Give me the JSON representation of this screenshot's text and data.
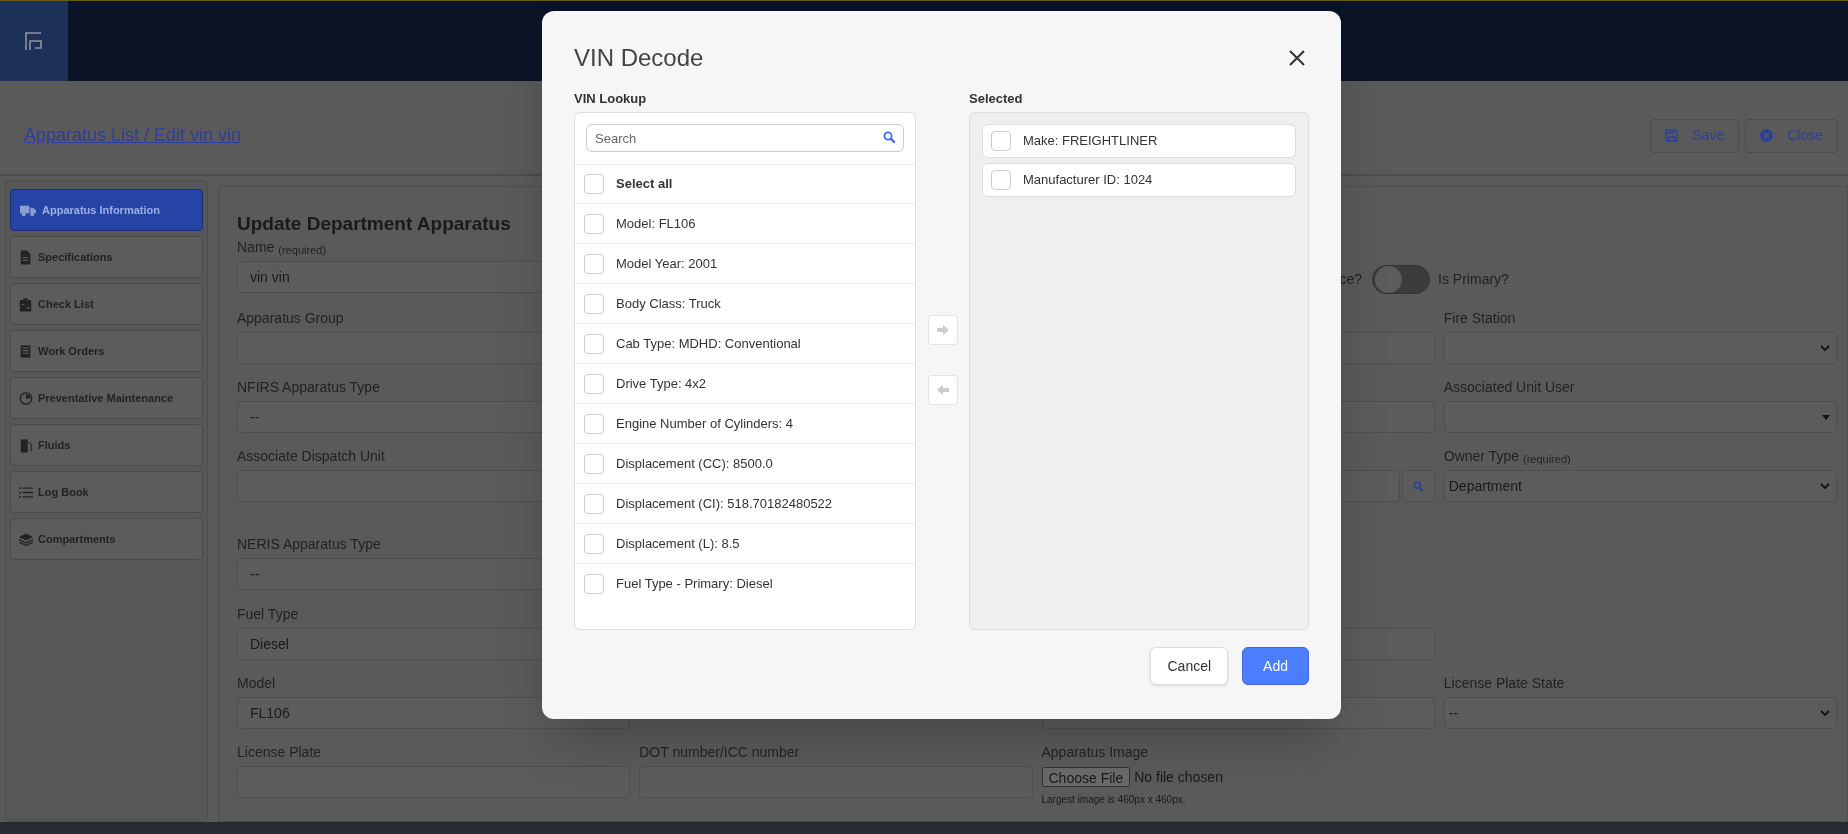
{
  "breadcrumb": "Apparatus List / Edit vin vin",
  "toolbar": [
    {
      "label": "Save",
      "kind": "save"
    },
    {
      "label": "Close",
      "kind": "close"
    }
  ],
  "sidebar": {
    "items": [
      {
        "label": "Apparatus Information",
        "kind": "truck",
        "selected": true
      },
      {
        "label": "Specifications",
        "kind": "document",
        "selected": false
      },
      {
        "label": "Check List",
        "kind": "clipboard",
        "selected": false
      },
      {
        "label": "Work Orders",
        "kind": "list-document",
        "selected": false
      },
      {
        "label": "Preventative Maintenance",
        "kind": "gauge",
        "selected": false
      },
      {
        "label": "Fluids",
        "kind": "fuel",
        "selected": false
      },
      {
        "label": "Log Book",
        "kind": "list",
        "selected": false
      },
      {
        "label": "Compartments",
        "kind": "layers",
        "selected": false
      }
    ]
  },
  "form": {
    "title": "Update Department Apparatus",
    "rows": [
      {
        "column_1": {
          "kind": "text",
          "label": "Name",
          "hint": "(required)",
          "value": "vin vin"
        },
        "column_3": {
          "kind": "toggles",
          "cut_label": "ce?",
          "toggle": {
            "label": "Is Primary?",
            "on": false
          }
        }
      },
      {
        "column_1": {
          "kind": "text",
          "label": "Apparatus Group"
        },
        "column_3": {
          "kind": "text"
        },
        "column_4": {
          "kind": "select",
          "label": "Fire Station"
        }
      },
      {
        "column_1": {
          "kind": "text",
          "label": "NFIRS Apparatus Type",
          "value": "--"
        },
        "column_3": {
          "kind": "text"
        },
        "column_4": {
          "kind": "dropdown",
          "label": "Associated Unit User"
        }
      },
      {
        "column_1": {
          "kind": "text",
          "label": "Associate Dispatch Unit"
        },
        "column_3": {
          "kind": "search"
        },
        "column_4": {
          "kind": "select",
          "label": "Owner Type",
          "hint": "(required)",
          "value": "Department"
        }
      },
      {
        "column_1": {
          "kind": "text",
          "label": "NERIS Apparatus Type",
          "value": "--"
        }
      },
      {
        "column_1": {
          "kind": "text",
          "label": "Fuel Type",
          "value": "Diesel"
        },
        "column_3": {
          "kind": "text"
        }
      },
      {
        "column_1": {
          "kind": "text",
          "label": "Model",
          "value": "FL106"
        },
        "column_3": {
          "kind": "text"
        },
        "column_4": {
          "kind": "select",
          "label": "License Plate State",
          "value": "--"
        }
      },
      {
        "column_1": {
          "kind": "text",
          "label": "License Plate"
        },
        "column_2": {
          "kind": "text",
          "label": "DOT number/ICC number"
        },
        "column_3": {
          "kind": "file",
          "label": "Apparatus Image",
          "button": "Choose File",
          "status": "No file chosen",
          "note": "Largest image is 460px x 460px."
        }
      }
    ]
  },
  "modal": {
    "title": "VIN Decode",
    "lookup": {
      "label": "VIN Lookup",
      "search": {
        "placeholder": "Search"
      },
      "select_all": {
        "label": "Select all",
        "checked": false
      },
      "items": [
        {
          "label": "Model: FL106",
          "checked": false
        },
        {
          "label": "Model Year: 2001",
          "checked": false
        },
        {
          "label": "Body Class: Truck",
          "checked": false
        },
        {
          "label": "Cab Type: MDHD: Conventional",
          "checked": false
        },
        {
          "label": "Drive Type: 4x2",
          "checked": false
        },
        {
          "label": "Engine Number of Cylinders: 4",
          "checked": false
        },
        {
          "label": "Displacement (CC): 8500.0",
          "checked": false
        },
        {
          "label": "Displacement (CI): 518.70182480522",
          "checked": false
        },
        {
          "label": "Displacement (L): 8.5",
          "checked": false
        },
        {
          "label": "Fuel Type - Primary: Diesel",
          "checked": false
        }
      ]
    },
    "selected": {
      "label": "Selected",
      "items": [
        {
          "label": "Make: FREIGHTLINER",
          "checked": false
        },
        {
          "label": "Manufacturer ID: 1024",
          "checked": false
        }
      ]
    },
    "buttons": [
      {
        "label": "Cancel",
        "kind": "secondary"
      },
      {
        "label": "Add",
        "kind": "primary"
      }
    ]
  }
}
